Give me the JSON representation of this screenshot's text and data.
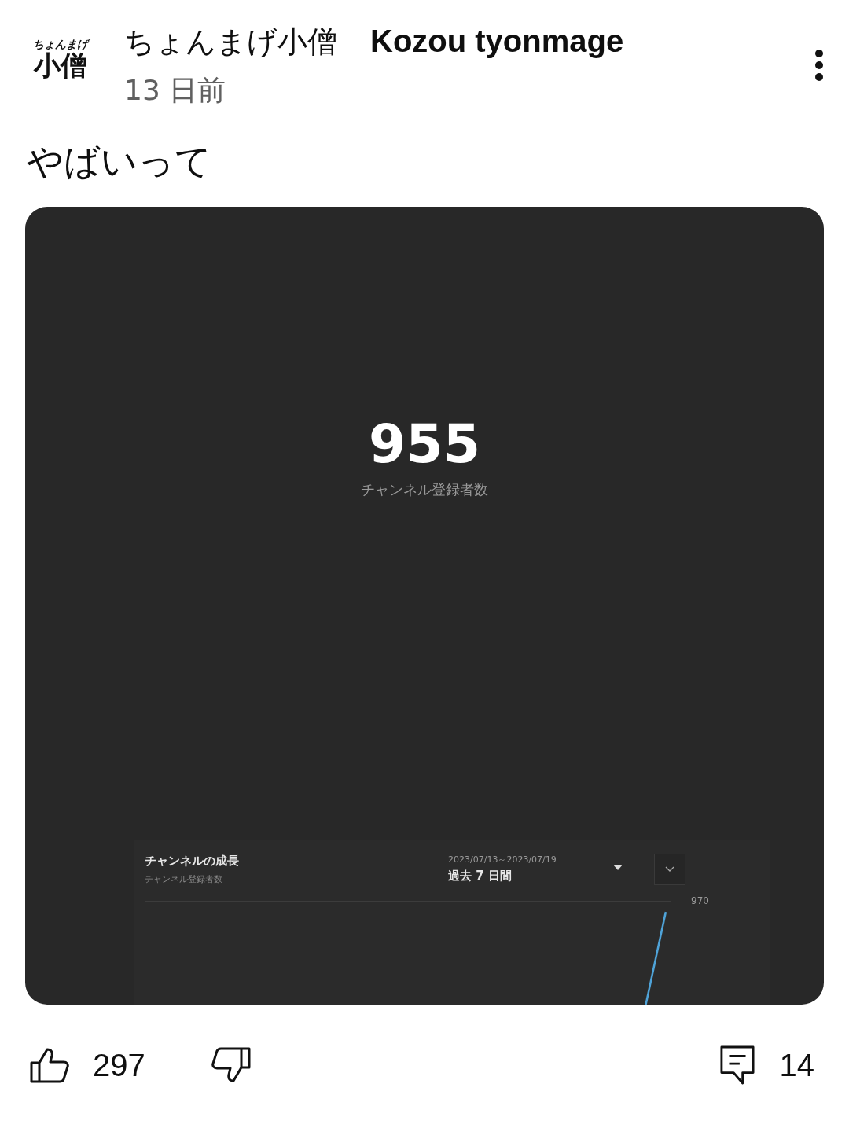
{
  "post": {
    "avatar": {
      "lines": [
        "ちょんまげ",
        "小僧"
      ]
    },
    "author": {
      "name_jp": "ちょんまげ小僧",
      "name_en": "Kozou tyonmage"
    },
    "time": "13 日前",
    "text": "やばいって",
    "screenshot": {
      "count": "955",
      "count_label": "チャンネル登録者数",
      "panel": {
        "title": "チャンネルの成長",
        "subtitle": "チャンネル登録者数",
        "date_range": "2023/07/13～2023/07/19",
        "period": "過去 7 日間",
        "axis_label": "970"
      }
    },
    "actions": {
      "likes": "297",
      "comments": "14"
    }
  }
}
